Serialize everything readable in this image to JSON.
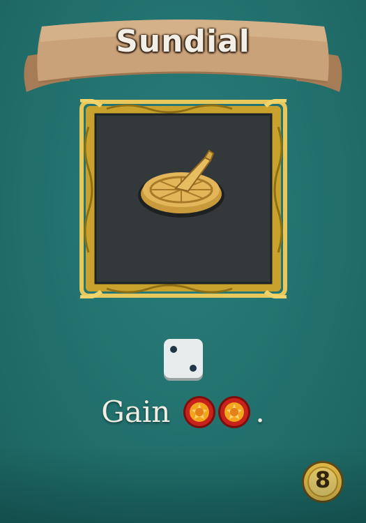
{
  "card": {
    "title": "Sundial",
    "effect_word": "Gain",
    "effect_punctuation": ".",
    "reward_icon": "coin-icon",
    "reward_count": 2,
    "die_face": 2,
    "die_icon": "die-icon",
    "illustration_icon": "sundial-icon",
    "cost": "8"
  },
  "colors": {
    "background": "#237370",
    "banner": "#c9a27a",
    "frame_gold": "#e6c24a",
    "frame_inner": "#33393b",
    "coin_red": "#c8221c",
    "coin_gold": "#f2a51e"
  }
}
